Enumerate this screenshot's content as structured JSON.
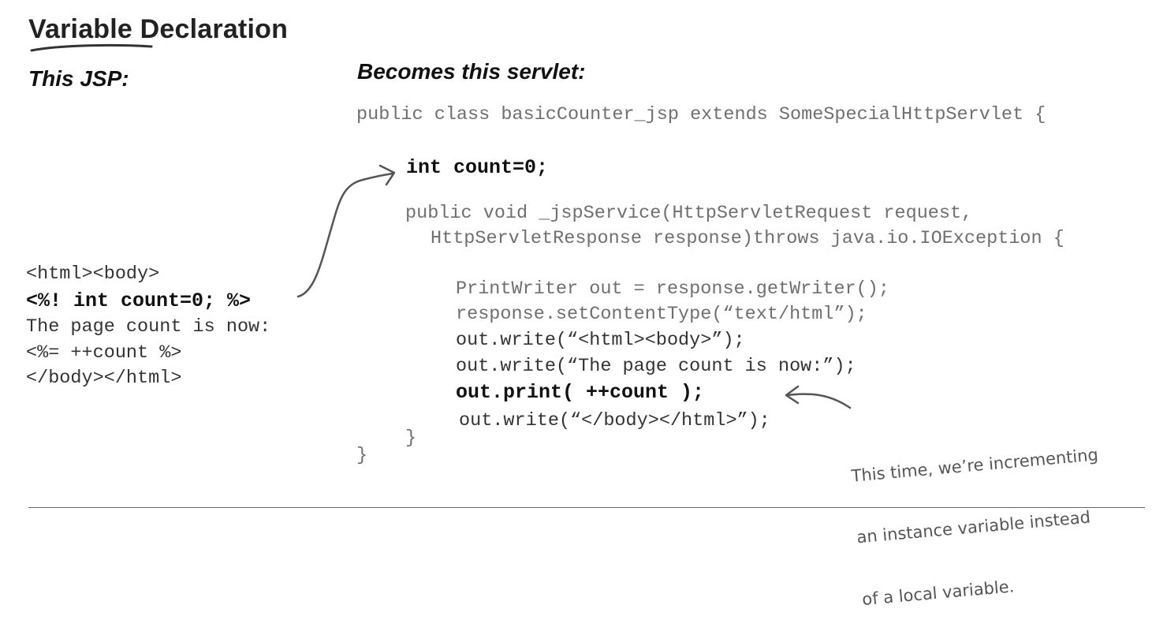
{
  "heading": {
    "title": "Variable Declaration",
    "left_label": "This JSP:",
    "right_label": "Becomes this servlet:"
  },
  "jsp": {
    "line1": "<html><body>",
    "line2": "<%! int count=0; %>",
    "line3": "The page count is now:",
    "line4": "<%= ++count %>",
    "line5": "</body></html>"
  },
  "servlet": {
    "class_decl": "public class basicCounter_jsp extends SomeSpecialHttpServlet {",
    "field": "int count=0;",
    "method_line1": "public void _jspService(HttpServletRequest request,",
    "method_line2": "HttpServletResponse response)throws java.io.IOException {",
    "body1": "PrintWriter out = response.getWriter();",
    "body2": "response.setContentType(“text/html”);",
    "body3": "out.write(“<html><body>”);",
    "body4": "out.write(“The page count is now:”);",
    "body5": "out.print( ++count );",
    "body6": "out.write(“</body></html>”);",
    "close_method": "}",
    "close_class": "}"
  },
  "annotation": {
    "line1": "This time, we’re incrementing",
    "line2": "an instance variable instead",
    "line3": "of a local variable."
  }
}
